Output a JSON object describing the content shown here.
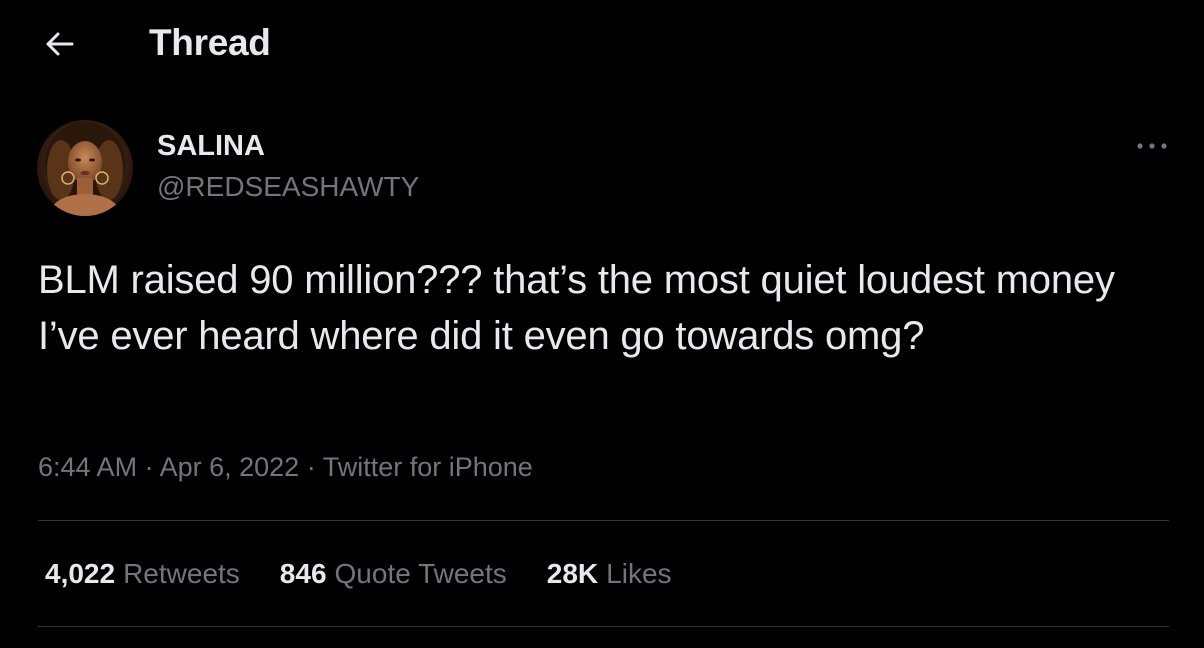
{
  "header": {
    "back_icon": "arrow-left-icon",
    "title": "Thread"
  },
  "tweet": {
    "author": {
      "display_name": "SALINA",
      "handle": "@REDSEASHAWTY",
      "avatar_icon": "profile-photo"
    },
    "more_icon": "more-dots-icon",
    "text": "BLM raised 90 million??? that’s the most quiet loudest money I’ve ever heard where did it even go towards omg?",
    "time": "6:44 AM",
    "date": "Apr 6, 2022",
    "source": "Twitter for iPhone",
    "separator": "·"
  },
  "stats": {
    "retweets": {
      "count": "4,022",
      "label": "Retweets"
    },
    "quotes": {
      "count": "846",
      "label": "Quote Tweets"
    },
    "likes": {
      "count": "28K",
      "label": "Likes"
    }
  },
  "colors": {
    "background": "#000000",
    "text_primary": "#e7e9ea",
    "text_secondary": "#71767b",
    "divider": "#2f3336"
  }
}
